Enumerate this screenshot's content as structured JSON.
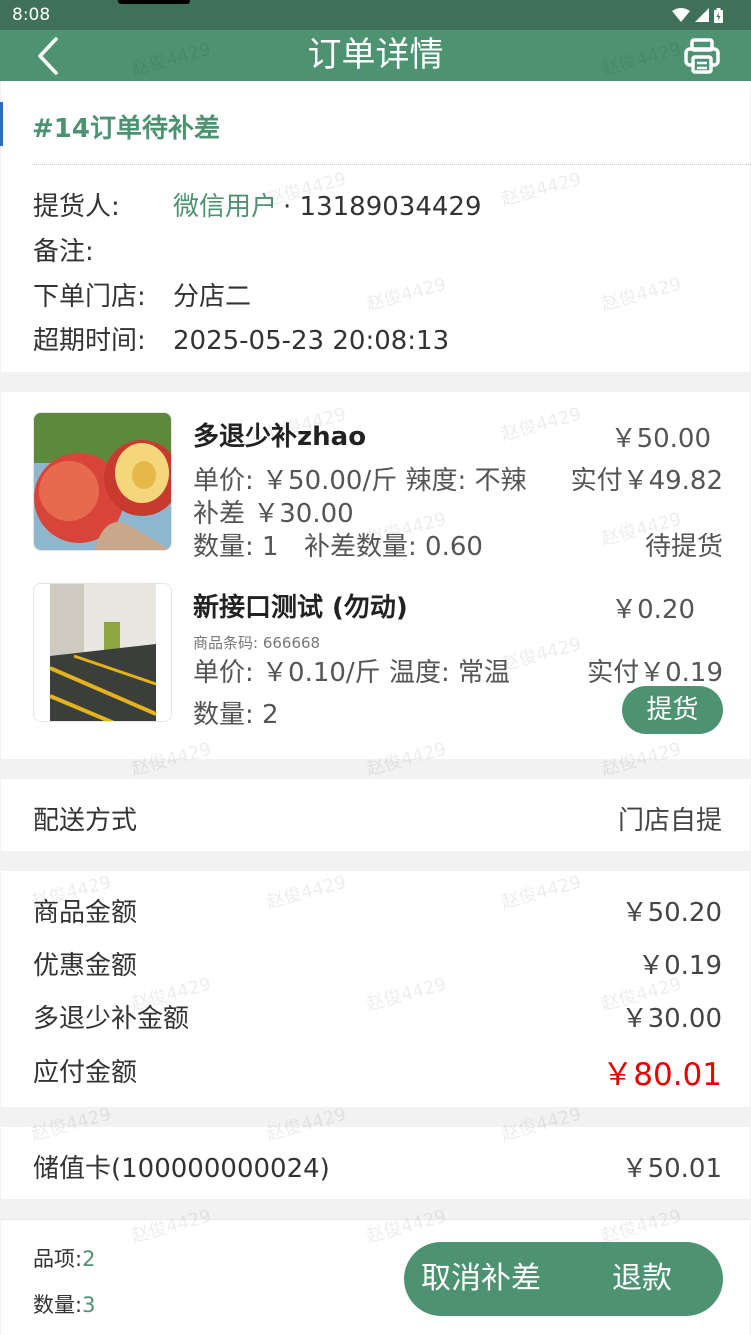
{
  "status_bar": {
    "time": "8:08"
  },
  "nav": {
    "title": "订单详情",
    "back_icon": "chevron-left-icon",
    "print_icon": "printer-icon"
  },
  "order": {
    "title": "#14订单待补差",
    "pickup_person_label": "提货人:",
    "pickup_person_name": "微信用户",
    "pickup_person_phone": "· 13189034429",
    "remark_label": "备注:",
    "store_label": "下单门店:",
    "store_value": "分店二",
    "expire_label": "超期时间:",
    "expire_value": "2025-05-23 20:08:13"
  },
  "products": [
    {
      "name": "多退少补zhao",
      "price": "￥50.00",
      "unit_price": "单价: ￥50.00/斤 辣度: 不辣",
      "paid": "实付￥49.82",
      "diff": "补差 ￥30.00",
      "qty": "数量: 1",
      "diff_qty": "补差数量: 0.60",
      "status": "待提货"
    },
    {
      "name": "新接口测试 (勿动)",
      "price": "￥0.20",
      "barcode": "商品条码: 666668",
      "unit_price": "单价: ￥0.10/斤 温度: 常温",
      "paid": "实付￥0.19",
      "qty": "数量: 2",
      "action": "提货"
    }
  ],
  "delivery": {
    "label": "配送方式",
    "value": "门店自提"
  },
  "amounts": [
    {
      "label": "商品金额",
      "value": "￥50.20"
    },
    {
      "label": "优惠金额",
      "value": "￥0.19"
    },
    {
      "label": "多退少补金额",
      "value": "￥30.00"
    },
    {
      "label": "应付金额",
      "value": "￥80.01"
    }
  ],
  "payment": {
    "label": "储值卡(100000000024)",
    "value": "￥50.01"
  },
  "footer": {
    "items_label": "品项:",
    "items_value": "2",
    "qty_label": "数量:",
    "qty_value": "3",
    "cancel_label": "取消补差",
    "refund_label": "退款"
  },
  "watermark": "赵俊4429",
  "colors": {
    "primary": "#4e9371",
    "status_bar": "#3e7158",
    "red": "#e60000"
  }
}
